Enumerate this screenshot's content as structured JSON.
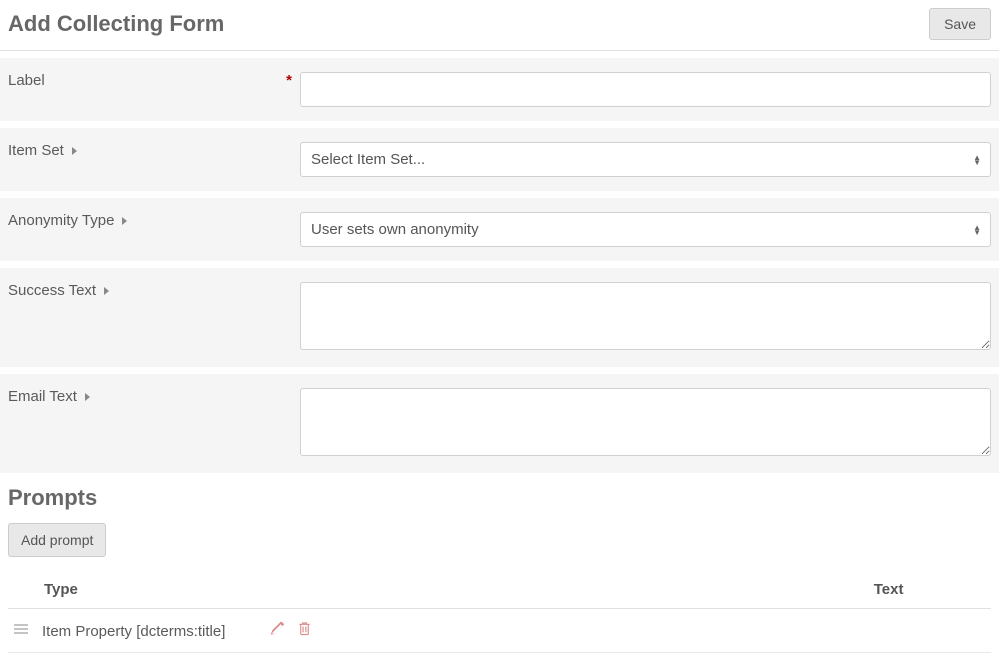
{
  "header": {
    "title": "Add Collecting Form",
    "save_label": "Save"
  },
  "form": {
    "label": {
      "text": "Label",
      "required": "*",
      "value": ""
    },
    "item_set": {
      "text": "Item Set",
      "placeholder": "Select Item Set..."
    },
    "anonymity": {
      "text": "Anonymity Type",
      "selected": "User sets own anonymity"
    },
    "success_text": {
      "text": "Success Text",
      "value": ""
    },
    "email_text": {
      "text": "Email Text",
      "value": ""
    }
  },
  "prompts": {
    "heading": "Prompts",
    "add_button": "Add prompt",
    "columns": {
      "type": "Type",
      "text": "Text"
    },
    "rows": [
      {
        "type": "Item Property [dcterms:title]",
        "text": ""
      }
    ]
  }
}
